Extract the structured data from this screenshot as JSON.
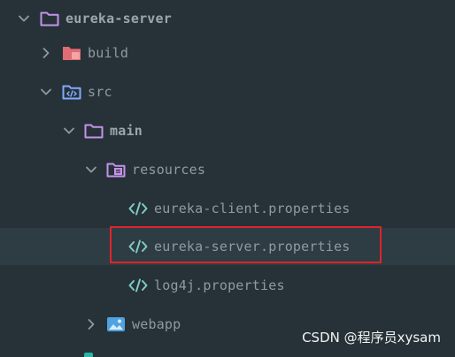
{
  "tree": {
    "root": {
      "label": "eureka-server",
      "expanded": true
    },
    "build": {
      "label": "build",
      "expanded": false
    },
    "src": {
      "label": "src",
      "expanded": true
    },
    "main": {
      "label": "main",
      "expanded": true
    },
    "resources": {
      "label": "resources",
      "expanded": true
    },
    "files": [
      {
        "label": "eureka-client.properties",
        "selected": false
      },
      {
        "label": "eureka-server.properties",
        "selected": true
      },
      {
        "label": "log4j.properties",
        "selected": false
      }
    ],
    "webapp": {
      "label": "webapp",
      "expanded": false
    }
  },
  "watermark": "CSDN @程序员xysam",
  "colors": {
    "background": "#263238",
    "selected_row": "#2e3c43",
    "text": "#8e9ba1",
    "folder_purple": "#c792ea",
    "excluded_red": "#f07178",
    "source_blue": "#82aaff",
    "properties_teal": "#80cbc4",
    "highlight_border": "#e0242b"
  }
}
